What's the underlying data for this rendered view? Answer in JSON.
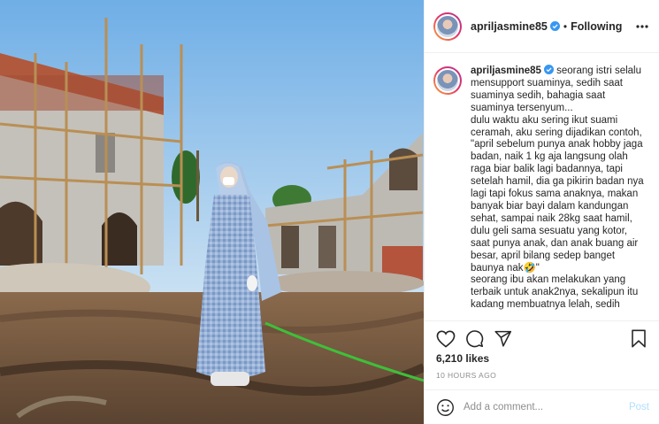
{
  "post": {
    "username": "apriljasmine85",
    "verified": true,
    "separator": "•",
    "follow_status": "Following",
    "caption": "seorang istri selalu mensupport suaminya, sedih saat suaminya sedih, bahagia saat suaminya tersenyum...\ndulu waktu aku sering ikut suami ceramah, aku sering dijadikan contoh, \"april sebelum punya anak hobby jaga badan, naik 1 kg aja langsung olah raga biar balik lagi badannya, tapi setelah hamil, dia ga pikirin badan nya lagi tapi fokus sama anaknya, makan banyak biar bayi dalam kandungan sehat, sampai naik 28kg saat hamil, dulu geli sama sesuatu yang kotor, saat punya anak, dan anak buang air besar, april bilang sedep banget baunya nak🤣\"\nseorang ibu akan melakukan yang terbaik untuk anak2nya, sekalipun itu kadang membuatnya lelah, sedih",
    "likes": "6,210 likes",
    "time": "10 HOURS AGO"
  },
  "comment": {
    "placeholder": "Add a comment...",
    "post_label": "Post"
  },
  "icons": {
    "more": "more-options-icon",
    "like": "heart-icon",
    "comment": "comment-bubble-icon",
    "share": "paper-plane-icon",
    "save": "bookmark-icon",
    "emoji": "smiley-icon",
    "verified": "verified-badge-icon"
  },
  "colors": {
    "verified_blue": "#3897f0",
    "post_disabled": "#b2dffc",
    "meta_gray": "#8e8e8e",
    "text": "#262626"
  }
}
